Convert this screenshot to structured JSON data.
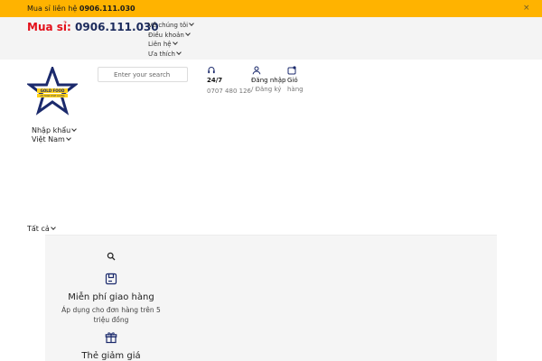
{
  "topbar": {
    "prefix": "Mua sỉ liên hệ",
    "phone": "0906.111.030",
    "close_label": "×"
  },
  "header": {
    "hotline_label": "Mua sỉ:",
    "hotline_number": "0906.111.030",
    "nav": [
      "Về chúng tôi",
      "Điều khoản",
      "Liên hệ",
      "Ưa thích"
    ]
  },
  "logo": {
    "text": "GOLD FOOD",
    "subtext": "AN TOAN CHAT LUONG",
    "icon": "star-logo"
  },
  "search": {
    "placeholder": "Enter your search"
  },
  "support": {
    "label": "24/7",
    "phone": "0707 480 126"
  },
  "account": {
    "login": "Đăng nhập",
    "register": "/ Đăng ký"
  },
  "cart": {
    "label_1": "Giỏ",
    "label_2": "hàng"
  },
  "location": {
    "line1": "Nhập khẩu",
    "line2": "Việt Nam"
  },
  "category": {
    "label": "Tất cả"
  },
  "features": [
    {
      "title": "Miễn phí giao hàng",
      "desc": "Áp dụng cho đơn hàng trên 5 triệu đồng",
      "icon": "shipping-box-icon"
    },
    {
      "title": "Thẻ giảm giá",
      "icon": "gift-icon"
    }
  ],
  "colors": {
    "accent": "#ffb300",
    "brand_red": "#e3101a",
    "brand_navy": "#1b2a5c"
  }
}
